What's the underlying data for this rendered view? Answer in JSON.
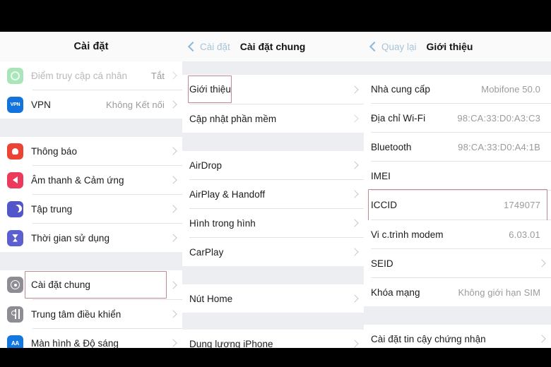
{
  "panes": [
    {
      "id": "settings",
      "header": {
        "title": "Cài đặt",
        "back": null
      },
      "groups": [
        {
          "items": [
            {
              "icon": "hotspot-icon",
              "label": "Điểm truy cập cá nhân",
              "value": "Tắt",
              "chevron": true,
              "dim": true
            },
            {
              "icon": "vpn-icon",
              "label": "VPN",
              "value": "Không Kết nối",
              "chevron": true
            }
          ]
        },
        {
          "items": [
            {
              "icon": "bell-icon",
              "label": "Thông báo",
              "value": "",
              "chevron": true
            },
            {
              "icon": "sound-icon",
              "label": "Âm thanh & Cảm ứng",
              "value": "",
              "chevron": true
            },
            {
              "icon": "moon-icon",
              "label": "Tập trung",
              "value": "",
              "chevron": true
            },
            {
              "icon": "hourglass-icon",
              "label": "Thời gian sử dụng",
              "value": "",
              "chevron": true
            }
          ]
        },
        {
          "items": [
            {
              "icon": "gear-icon",
              "label": "Cài đặt chung",
              "value": "",
              "chevron": true,
              "highlight": true
            },
            {
              "icon": "control-center-icon",
              "label": "Trung tâm điều khiển",
              "value": "",
              "chevron": true
            },
            {
              "icon": "display-icon",
              "label": "Màn hình & Độ sáng",
              "value": "",
              "chevron": true
            }
          ]
        }
      ]
    },
    {
      "id": "general",
      "header": {
        "title": "Cài đặt chung",
        "back": "Cài đặt"
      },
      "groups": [
        {
          "items": [
            {
              "label": "Giới thiệu",
              "value": "",
              "chevron": true,
              "highlight": true
            },
            {
              "label": "Cập nhật phần mềm",
              "value": "",
              "chevron": true,
              "dimChevron": true
            }
          ]
        },
        {
          "items": [
            {
              "label": "AirDrop",
              "value": "",
              "chevron": true
            },
            {
              "label": "AirPlay & Handoff",
              "value": "",
              "chevron": true
            },
            {
              "label": "Hình trong hình",
              "value": "",
              "chevron": true
            },
            {
              "label": "CarPlay",
              "value": "",
              "chevron": true
            }
          ]
        },
        {
          "items": [
            {
              "label": "Nút Home",
              "value": "",
              "chevron": true
            }
          ]
        },
        {
          "items": [
            {
              "label": "Dung lượng iPhone",
              "value": "",
              "chevron": true
            }
          ]
        }
      ]
    },
    {
      "id": "about",
      "header": {
        "title": "Giới thiệu",
        "back": "Quay lại"
      },
      "groups": [
        {
          "items": [
            {
              "label": "Nhà cung cấp",
              "value": "Mobifone 50.0",
              "chevron": false
            },
            {
              "label": "Địa chỉ Wi-Fi",
              "value": "98:CA:33:D0:A3:C3",
              "chevron": false
            },
            {
              "label": "Bluetooth",
              "value": "98:CA:33:D0:A4:1B",
              "chevron": false
            },
            {
              "label": "IMEI",
              "value": "",
              "chevron": false
            },
            {
              "label": "ICCID",
              "value": "1749077",
              "chevron": false,
              "highlight": true
            },
            {
              "label": "Vi c.trình modem",
              "value": "6.03.01",
              "chevron": false
            },
            {
              "label": "SEID",
              "value": "",
              "chevron": true
            },
            {
              "label": "Khóa mạng",
              "value": "Không giới hạn SIM",
              "chevron": false
            }
          ]
        },
        {
          "items": [
            {
              "label": "Cài đặt tin cậy chứng nhận",
              "value": "",
              "chevron": true
            }
          ]
        }
      ]
    }
  ],
  "icon_glyphs": {
    "vpn-icon": "VPN",
    "display-icon": "AA"
  },
  "colors": {
    "highlight_border": "#c08a8e",
    "back_link": "#a8c4d8",
    "value_text": "#9b9b9f",
    "group_gap": "#edeef2",
    "bar": "#000000"
  }
}
